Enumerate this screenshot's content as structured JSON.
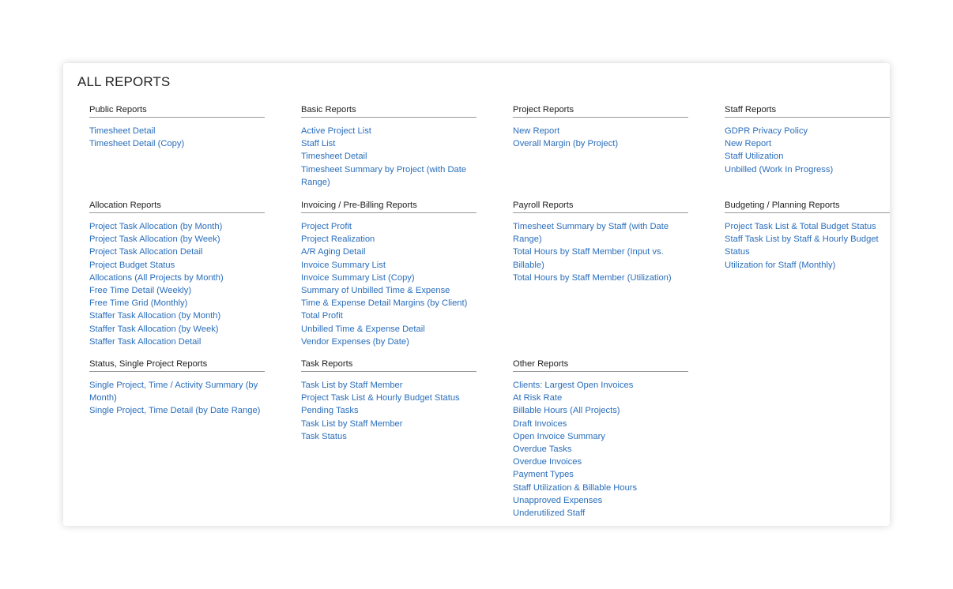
{
  "title": "ALL REPORTS",
  "colors": {
    "link": "#2a6ebb",
    "text": "#222222",
    "rule": "#9a9a9a"
  },
  "sections": [
    {
      "title": "Public Reports",
      "items": [
        "Timesheet Detail",
        "Timesheet Detail (Copy)"
      ]
    },
    {
      "title": "Basic Reports",
      "items": [
        "Active Project List",
        "Staff List",
        "Timesheet Detail",
        "Timesheet Summary by Project (with Date Range)"
      ]
    },
    {
      "title": "Project Reports",
      "items": [
        "New Report",
        "Overall Margin (by Project)"
      ]
    },
    {
      "title": "Staff Reports",
      "items": [
        "GDPR Privacy Policy",
        "New Report",
        "Staff Utilization",
        "Unbilled (Work In Progress)"
      ]
    },
    {
      "title": "Allocation Reports",
      "items": [
        "Project Task Allocation (by Month)",
        "Project Task Allocation (by Week)",
        "Project Task Allocation Detail",
        "Project Budget Status",
        "Allocations (All Projects by Month)",
        "Free Time Detail (Weekly)",
        "Free Time Grid (Monthly)",
        "Staffer Task Allocation (by Month)",
        "Staffer Task Allocation (by Week)",
        "Staffer Task Allocation Detail"
      ]
    },
    {
      "title": "Invoicing / Pre-Billing Reports",
      "items": [
        "Project Profit",
        "Project Realization",
        "A/R Aging Detail",
        "Invoice Summary List",
        "Invoice Summary List (Copy)",
        "Summary of Unbilled Time & Expense",
        "Time & Expense Detail Margins (by Client)",
        "Total Profit",
        "Unbilled Time & Expense Detail",
        "Vendor Expenses (by Date)"
      ]
    },
    {
      "title": "Payroll Reports",
      "items": [
        "Timesheet Summary by Staff (with Date Range)",
        "Total Hours by Staff Member (Input vs. Billable)",
        "Total Hours by Staff Member (Utilization)"
      ]
    },
    {
      "title": "Budgeting / Planning Reports",
      "items": [
        "Project Task List & Total Budget Status",
        "Staff Task List by Staff & Hourly Budget Status",
        "Utilization for Staff (Monthly)"
      ]
    },
    {
      "title": "Status, Single Project Reports",
      "items": [
        "Single Project, Time / Activity Summary (by Month)",
        "Single Project, Time Detail (by Date Range)"
      ]
    },
    {
      "title": "Task Reports",
      "items": [
        "Task List by Staff Member",
        "Project Task List & Hourly Budget Status",
        "Pending Tasks",
        "Task List by Staff Member",
        "Task Status"
      ]
    },
    {
      "title": "Other Reports",
      "items": [
        "Clients: Largest Open Invoices",
        "At Risk Rate",
        "Billable Hours (All Projects)",
        "Draft Invoices",
        "Open Invoice Summary",
        "Overdue Tasks",
        "Overdue Invoices",
        "Payment Types",
        "Staff Utilization & Billable Hours",
        "Unapproved Expenses",
        "Underutilized Staff"
      ]
    }
  ]
}
